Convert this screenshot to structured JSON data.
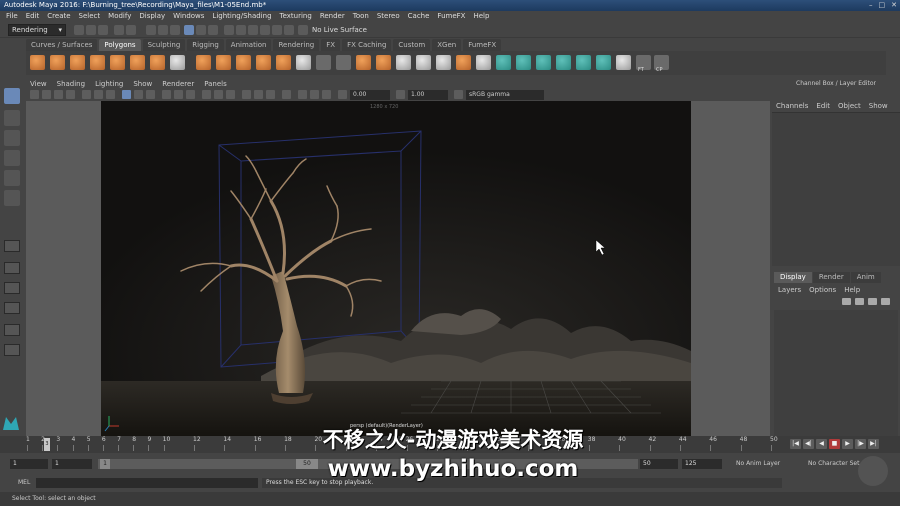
{
  "window": {
    "title": "Autodesk Maya 2016: F:\\Burning_tree\\Recording\\Maya_files\\M1-05End.mb*",
    "controls": [
      "–",
      "□",
      "✕"
    ]
  },
  "menubar": [
    "File",
    "Edit",
    "Create",
    "Select",
    "Modify",
    "Display",
    "Windows",
    "Lighting/Shading",
    "Texturing",
    "Render",
    "Toon",
    "Stereo",
    "Cache",
    "FumeFX",
    "Help"
  ],
  "statusline": {
    "mode": "Rendering",
    "live_surface": "No Live Surface"
  },
  "shelf": {
    "tabs": [
      "Curves / Surfaces",
      "Polygons",
      "Sculpting",
      "Rigging",
      "Animation",
      "Rendering",
      "FX",
      "FX Caching",
      "Custom",
      "XGen",
      "FumeFX"
    ],
    "active_tab": "Polygons",
    "labels": [
      "FT",
      "CP"
    ]
  },
  "panel": {
    "menu": [
      "View",
      "Shading",
      "Lighting",
      "Show",
      "Renderer",
      "Panels"
    ],
    "field_a": "0.00",
    "field_b": "1.00",
    "field_c": "sRGB gamma",
    "resolution_label": "1280 x 720",
    "camera_label": "persp (default)(RenderLayer)"
  },
  "channel_box": {
    "title": "Channel Box / Layer Editor",
    "menu": [
      "Channels",
      "Edit",
      "Object",
      "Show"
    ]
  },
  "layer_editor": {
    "tabs": [
      "Display",
      "Render",
      "Anim"
    ],
    "active_tab": "Display",
    "menu": [
      "Layers",
      "Options",
      "Help"
    ]
  },
  "timeslider": {
    "current_frame": "3",
    "tick_labels": [
      "1",
      "2",
      "3",
      "4",
      "5",
      "6",
      "7",
      "8",
      "9",
      "10",
      "12",
      "14",
      "16",
      "18",
      "20",
      "22",
      "24",
      "26",
      "28",
      "30",
      "32",
      "34",
      "36",
      "38",
      "40",
      "42",
      "44",
      "46",
      "48",
      "50"
    ],
    "buttons": [
      "|◀",
      "◀|",
      "◀",
      "▶",
      "|▶",
      "▶|",
      "▶▶"
    ]
  },
  "range": {
    "start_anim": "1",
    "start_range": "1",
    "handle_start": "1",
    "handle_end": "50",
    "end_range": "50",
    "end_anim": "125",
    "anim_layer": "No Anim Layer",
    "character_set": "No Character Set"
  },
  "command": {
    "mel_label": "MEL",
    "result": "Press the ESC key to stop playback."
  },
  "helpline": "Select Tool: select an object",
  "watermark": {
    "line1": "不移之火-动漫游戏美术资源",
    "line2": "www.byzhihuo.com"
  }
}
